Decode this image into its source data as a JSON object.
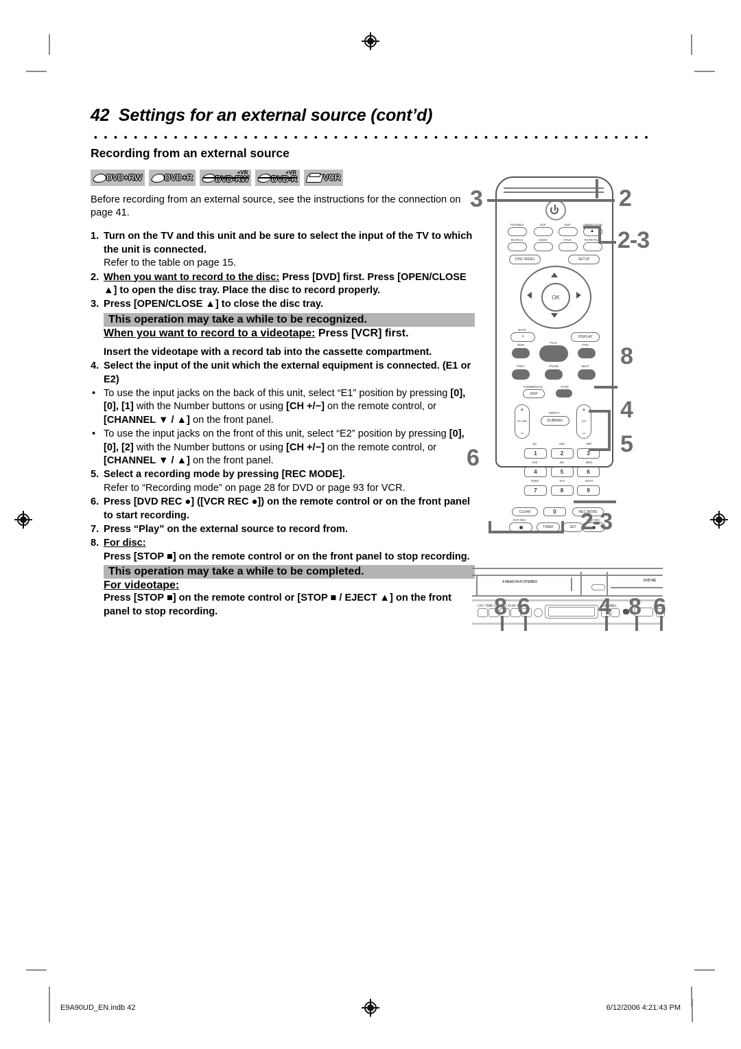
{
  "header": {
    "page_number": "42",
    "title": "Settings for an external source (cont’d)",
    "subtitle": "Recording from an external source"
  },
  "badges": [
    {
      "label": "DVD+RW",
      "vr": "",
      "icon": "disc-icon"
    },
    {
      "label": "DVD+R",
      "vr": "",
      "icon": "disc-icon"
    },
    {
      "label": "DVD-RW",
      "vr": "+VR",
      "icon": "disc-icon"
    },
    {
      "label": "DVD-R",
      "vr": "+VR",
      "icon": "disc-icon"
    },
    {
      "label": "VCR",
      "vr": "",
      "icon": "videotape-icon"
    }
  ],
  "intro": "Before recording from an external source, see the instructions for the connection on page 41.",
  "steps": {
    "s1_num": "1.",
    "s1_bold": "Turn on the TV and this unit and be sure to select the input of the TV to which the unit is connected.",
    "s1_note": "Refer to the table on page 15.",
    "s2_num": "2.",
    "s2_underline": "When you want to record to the disc:",
    "s2_rest": " Press [DVD] first.",
    "s2_line2": "Press [OPEN/CLOSE ▲] to open the disc tray. Place the disc to record properly.",
    "s3_num": "3.",
    "s3_bold": "Press [OPEN/CLOSE ▲] to close the disc tray.",
    "hl1": "This operation may take a while to be recognized.",
    "s3_underline": "When you want to record to a videotape:",
    "s3_rest": " Press [VCR] first.",
    "s3_line3": "Insert the videotape with a record tab into the cassette compartment.",
    "s4_num": "4.",
    "s4_bold": "Select the input of the unit which the external equipment is connected. (E1 or E2)",
    "b1_a": "To use the input jacks on the back of this unit, select “E1” position by pressing ",
    "b1_b": "[0], [0], [1]",
    "b1_c": " with the Number buttons or using ",
    "b1_d": "[CH +/−]",
    "b1_e": " on the remote control, or ",
    "b1_f": "[CHANNEL ▼ / ▲]",
    "b1_g": " on the front panel.",
    "b2_a": "To use the input jacks on the front of this unit, select “E2” position by pressing ",
    "b2_b": "[0], [0], [2]",
    "s5_num": "5.",
    "s5_bold": "Select a recording mode by pressing [REC MODE].",
    "s5_note": "Refer to “Recording mode” on page 28 for DVD or page 93 for VCR.",
    "s6_num": "6.",
    "s6_bold": "Press [DVD REC ●] ([VCR REC ●]) on the remote control or on the front panel to start recording.",
    "s7_num": "7.",
    "s7_bold": "Press “Play” on the external source to record from.",
    "s8_num": "8.",
    "s8_underline": "For disc:",
    "s8_line2": "Press [STOP ■] on the remote control or on the front panel to stop recording.",
    "hl2": "This operation may take a while to be completed.",
    "s8_underline2": "For videotape:",
    "s8_line3": "Press [STOP ■] on the remote control or [STOP ■ / EJECT ▲] on the front panel to stop recording."
  },
  "remote": {
    "row1": [
      "TV/VIDEO",
      "VCR",
      "DVD",
      "OPEN/CLOSE"
    ],
    "row2": [
      "SEARCH",
      "AUDIO",
      "TITLE",
      "RAPID PLAY"
    ],
    "disc_menu": "DISC MENU",
    "setup": "SETUP",
    "ok": "OK",
    "back": "BACK",
    "display": "DISPLAY",
    "rew": "REW",
    "play": "PLAY",
    "ffw": "FFW",
    "prev": "PREV",
    "pause": "PAUSE",
    "next": "NEXT",
    "commercial": "COMMERCIAL",
    "skip": "SKIP",
    "stop": "STOP",
    "tv_vol": "TV VOL",
    "direct": "DIRECT",
    "dubbing": "DUBBING",
    "ch": "CH",
    "plus": "+",
    "minus": "−",
    "numbers": [
      {
        "key": "1",
        "letters": "@/:"
      },
      {
        "key": "2",
        "letters": "ABC"
      },
      {
        "key": "3",
        "letters": "DEF"
      },
      {
        "key": "4",
        "letters": "GHI"
      },
      {
        "key": "5",
        "letters": "JKL"
      },
      {
        "key": "6",
        "letters": "MNO"
      },
      {
        "key": "7",
        "letters": "PQRS"
      },
      {
        "key": "8",
        "letters": "TUV"
      },
      {
        "key": "9",
        "letters": "WXYZ"
      }
    ],
    "clear": "CLEAR",
    "zero": "0",
    "rec_mode": "REC MODE",
    "vcr_rec": "VCR REC",
    "timer": "TIMER",
    "set": "SET",
    "dvd_rec": "DVD REC"
  },
  "front_panel": {
    "stereo_label": "4 HEAD HI-FI STEREO",
    "dvd_label": "DVD RE"
  },
  "callouts": {
    "remote": [
      {
        "id": "c3",
        "label": "3"
      },
      {
        "id": "c2",
        "label": "2"
      },
      {
        "id": "c23",
        "label": "2-3"
      },
      {
        "id": "c8",
        "label": "8"
      },
      {
        "id": "c4",
        "label": "4"
      },
      {
        "id": "c5",
        "label": "5"
      },
      {
        "id": "c6",
        "label": "6"
      }
    ],
    "panel": [
      {
        "id": "p23",
        "label": "2-3"
      },
      {
        "id": "p8a",
        "label": "8"
      },
      {
        "id": "p6a",
        "label": "6"
      },
      {
        "id": "p4",
        "label": "4"
      },
      {
        "id": "p8b",
        "label": "8"
      },
      {
        "id": "p6b",
        "label": "6"
      }
    ]
  },
  "footer": {
    "file": "E9A90UD_EN.indb   42",
    "timestamp": "6/12/2006   4:21:43 PM"
  }
}
